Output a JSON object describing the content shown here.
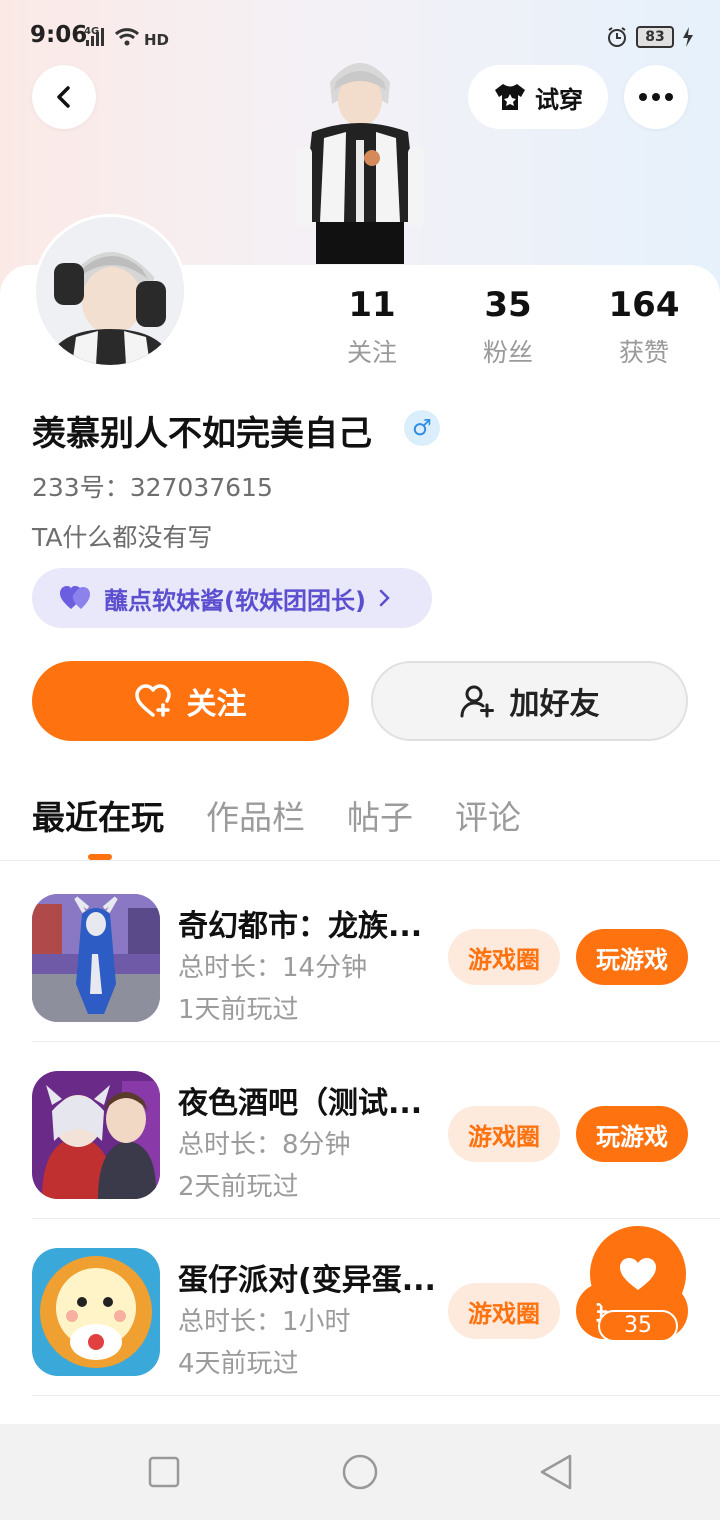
{
  "status_bar": {
    "time": "9:06",
    "network": "4G",
    "hd": "HD",
    "battery": "83"
  },
  "header": {
    "tryon_label": "试穿"
  },
  "profile": {
    "stats": [
      {
        "value": "11",
        "label": "关注"
      },
      {
        "value": "35",
        "label": "粉丝"
      },
      {
        "value": "164",
        "label": "获赞"
      }
    ],
    "username": "羡慕别人不如完美自己",
    "gender_symbol": "♂",
    "uid": "233号：327037615",
    "bio": "TA什么都没有写",
    "group_pill": "蘸点软妹酱(软妹团团长)"
  },
  "actions": {
    "follow": "关注",
    "add_friend": "加好友"
  },
  "tabs": [
    "最近在玩",
    "作品栏",
    "帖子",
    "评论"
  ],
  "games": [
    {
      "title": "奇幻都市：龙族...",
      "duration": "总时长：14分钟",
      "last_played": "1天前玩过",
      "circle": "游戏圈",
      "play": "玩游戏"
    },
    {
      "title": "夜色酒吧（测试...",
      "duration": "总时长：8分钟",
      "last_played": "2天前玩过",
      "circle": "游戏圈",
      "play": "玩游戏"
    },
    {
      "title": "蛋仔派对(变异蛋...",
      "duration": "总时长：1小时",
      "last_played": "4天前玩过",
      "circle": "游戏圈",
      "play": "玩游戏"
    }
  ],
  "floating_like": {
    "count": "35"
  },
  "colors": {
    "accent": "#ff7210",
    "pill_bg": "#e9e8fa",
    "pill_text": "#5b4fd0"
  }
}
